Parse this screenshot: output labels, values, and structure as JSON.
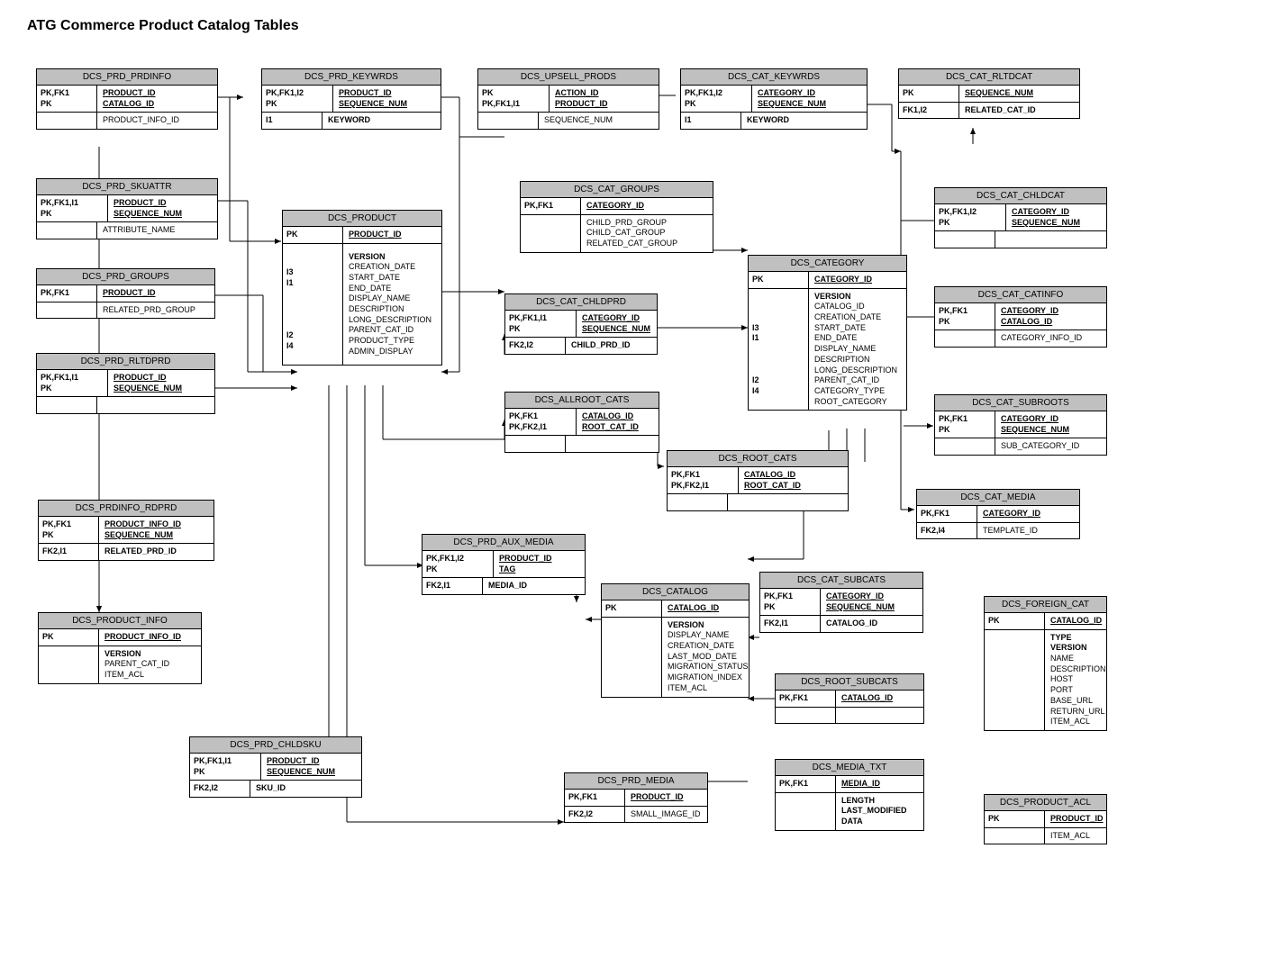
{
  "title": "ATG Commerce Product Catalog Tables",
  "tables": {
    "prd_prdinfo": {
      "name": "DCS_PRD_PRDINFO",
      "rows": [
        {
          "k": [
            "PK,FK1",
            "PK"
          ],
          "v": [
            "PRODUCT_ID",
            "CATALOG_ID"
          ],
          "ui": true
        },
        {
          "k": [
            ""
          ],
          "v": [
            "PRODUCT_INFO_ID"
          ],
          "vi": false
        }
      ]
    },
    "prd_skuattr": {
      "name": "DCS_PRD_SKUATTR",
      "rows": [
        {
          "k": [
            "PK,FK1,I1",
            "PK"
          ],
          "v": [
            "PRODUCT_ID",
            "SEQUENCE_NUM"
          ],
          "ui": true
        },
        {
          "k": [
            ""
          ],
          "v": [
            "ATTRIBUTE_NAME"
          ],
          "vi": false
        }
      ]
    },
    "prd_groups": {
      "name": "DCS_PRD_GROUPS",
      "rows": [
        {
          "k": [
            "PK,FK1"
          ],
          "v": [
            "PRODUCT_ID"
          ],
          "ui": true
        },
        {
          "k": [
            ""
          ],
          "v": [
            "RELATED_PRD_GROUP"
          ],
          "vi": false
        }
      ]
    },
    "prd_rltdprd": {
      "name": "DCS_PRD_RLTDPRD",
      "rows": [
        {
          "k": [
            "PK,FK1,I1",
            "PK"
          ],
          "v": [
            "PRODUCT_ID",
            "SEQUENCE_NUM"
          ],
          "ui": true
        },
        {
          "k": [
            ""
          ],
          "v": [
            ""
          ],
          "vi": false
        }
      ]
    },
    "prdinfo_rdprd": {
      "name": "DCS_PRDINFO_RDPRD",
      "rows": [
        {
          "k": [
            "PK,FK1",
            "PK"
          ],
          "v": [
            "PRODUCT_INFO_ID",
            "SEQUENCE_NUM"
          ],
          "ui": true
        },
        {
          "k": [
            "FK2,I1"
          ],
          "v": [
            "RELATED_PRD_ID"
          ],
          "vi": true
        }
      ]
    },
    "product_info": {
      "name": "DCS_PRODUCT_INFO",
      "rows": [
        {
          "k": [
            "PK"
          ],
          "v": [
            "PRODUCT_INFO_ID"
          ],
          "ui": true
        },
        {
          "k": [
            ""
          ],
          "v": [
            "VERSION",
            "PARENT_CAT_ID",
            "ITEM_ACL"
          ],
          "vi": false,
          "firstbold": true
        }
      ]
    },
    "prd_chldsku": {
      "name": "DCS_PRD_CHLDSKU",
      "rows": [
        {
          "k": [
            "PK,FK1,I1",
            "PK"
          ],
          "v": [
            "PRODUCT_ID",
            "SEQUENCE_NUM"
          ],
          "ui": true
        },
        {
          "k": [
            "FK2,I2"
          ],
          "v": [
            "SKU_ID"
          ],
          "vi": true
        }
      ]
    },
    "prd_keywrds": {
      "name": "DCS_PRD_KEYWRDS",
      "rows": [
        {
          "k": [
            "PK,FK1,I2",
            "PK"
          ],
          "v": [
            "PRODUCT_ID",
            "SEQUENCE_NUM"
          ],
          "ui": true
        },
        {
          "k": [
            "I1"
          ],
          "v": [
            "KEYWORD"
          ],
          "vi": true
        }
      ]
    },
    "product": {
      "name": "DCS_PRODUCT",
      "rows": [
        {
          "k": [
            "PK"
          ],
          "v": [
            "PRODUCT_ID"
          ],
          "ui": true
        },
        {
          "k": [
            "",
            "",
            "I3",
            "I1",
            "",
            "",
            "",
            "",
            "I2",
            "I4",
            ""
          ],
          "v": [
            "VERSION",
            "CREATION_DATE",
            "START_DATE",
            "END_DATE",
            "DISPLAY_NAME",
            "DESCRIPTION",
            "LONG_DESCRIPTION",
            "PARENT_CAT_ID",
            "PRODUCT_TYPE",
            "ADMIN_DISPLAY"
          ],
          "vi": false,
          "firstbold": true
        }
      ]
    },
    "upsell_prods": {
      "name": "DCS_UPSELL_PRODS",
      "rows": [
        {
          "k": [
            "PK",
            "PK,FK1,I1"
          ],
          "v": [
            "ACTION_ID",
            "PRODUCT_ID"
          ],
          "ui": true
        },
        {
          "k": [
            ""
          ],
          "v": [
            "SEQUENCE_NUM"
          ],
          "vi": false
        }
      ]
    },
    "prd_aux_media": {
      "name": "DCS_PRD_AUX_MEDIA",
      "rows": [
        {
          "k": [
            "PK,FK1,I2",
            "PK"
          ],
          "v": [
            "PRODUCT_ID",
            "TAG"
          ],
          "ui": true
        },
        {
          "k": [
            "FK2,I1"
          ],
          "v": [
            "MEDIA_ID"
          ],
          "vi": true
        }
      ]
    },
    "cat_groups": {
      "name": "DCS_CAT_GROUPS",
      "rows": [
        {
          "k": [
            "PK,FK1"
          ],
          "v": [
            "CATEGORY_ID"
          ],
          "ui": true
        },
        {
          "k": [
            ""
          ],
          "v": [
            "CHILD_PRD_GROUP",
            "CHILD_CAT_GROUP",
            "RELATED_CAT_GROUP"
          ],
          "vi": false
        }
      ]
    },
    "cat_chldprd": {
      "name": "DCS_CAT_CHLDPRD",
      "rows": [
        {
          "k": [
            "PK,FK1,I1",
            "PK"
          ],
          "v": [
            "CATEGORY_ID",
            "SEQUENCE_NUM"
          ],
          "ui": true
        },
        {
          "k": [
            "FK2,I2"
          ],
          "v": [
            "CHILD_PRD_ID"
          ],
          "vi": true
        }
      ]
    },
    "allroot_cats": {
      "name": "DCS_ALLROOT_CATS",
      "rows": [
        {
          "k": [
            "PK,FK1",
            "PK,FK2,I1"
          ],
          "v": [
            "CATALOG_ID",
            "ROOT_CAT_ID"
          ],
          "ui": true
        },
        {
          "k": [
            ""
          ],
          "v": [
            ""
          ],
          "vi": false
        }
      ]
    },
    "catalog": {
      "name": "DCS_CATALOG",
      "rows": [
        {
          "k": [
            "PK"
          ],
          "v": [
            "CATALOG_ID"
          ],
          "ui": true
        },
        {
          "k": [
            ""
          ],
          "v": [
            "VERSION",
            "DISPLAY_NAME",
            "CREATION_DATE",
            "LAST_MOD_DATE",
            "MIGRATION_STATUS",
            "MIGRATION_INDEX",
            "ITEM_ACL"
          ],
          "vi": false,
          "firstbold": true
        }
      ]
    },
    "prd_media": {
      "name": "DCS_PRD_MEDIA",
      "rows": [
        {
          "k": [
            "PK,FK1"
          ],
          "v": [
            "PRODUCT_ID"
          ],
          "ui": true
        },
        {
          "k": [
            "FK2,I2"
          ],
          "v": [
            "SMALL_IMAGE_ID"
          ],
          "vi": false
        }
      ]
    },
    "cat_keywrds": {
      "name": "DCS_CAT_KEYWRDS",
      "rows": [
        {
          "k": [
            "PK,FK1,I2",
            "PK"
          ],
          "v": [
            "CATEGORY_ID",
            "SEQUENCE_NUM"
          ],
          "ui": true
        },
        {
          "k": [
            "I1"
          ],
          "v": [
            "KEYWORD"
          ],
          "vi": true
        }
      ]
    },
    "category": {
      "name": "DCS_CATEGORY",
      "rows": [
        {
          "k": [
            "PK"
          ],
          "v": [
            "CATEGORY_ID"
          ],
          "ui": true
        },
        {
          "k": [
            "",
            "",
            "",
            "I3",
            "I1",
            "",
            "",
            "",
            "I2",
            "I4",
            ""
          ],
          "v": [
            "VERSION",
            "CATALOG_ID",
            "CREATION_DATE",
            "START_DATE",
            "END_DATE",
            "DISPLAY_NAME",
            "DESCRIPTION",
            "LONG_DESCRIPTION",
            "PARENT_CAT_ID",
            "CATEGORY_TYPE",
            "ROOT_CATEGORY"
          ],
          "vi": false,
          "firstbold": true
        }
      ]
    },
    "root_cats": {
      "name": "DCS_ROOT_CATS",
      "rows": [
        {
          "k": [
            "PK,FK1",
            "PK,FK2,I1"
          ],
          "v": [
            "CATALOG_ID",
            "ROOT_CAT_ID"
          ],
          "ui": true
        },
        {
          "k": [
            ""
          ],
          "v": [
            ""
          ],
          "vi": false
        }
      ]
    },
    "cat_subcats": {
      "name": "DCS_CAT_SUBCATS",
      "rows": [
        {
          "k": [
            "PK,FK1",
            "PK"
          ],
          "v": [
            "CATEGORY_ID",
            "SEQUENCE_NUM"
          ],
          "ui": true
        },
        {
          "k": [
            "FK2,I1"
          ],
          "v": [
            "CATALOG_ID"
          ],
          "vi": true
        }
      ]
    },
    "root_subcats": {
      "name": "DCS_ROOT_SUBCATS",
      "rows": [
        {
          "k": [
            "PK,FK1"
          ],
          "v": [
            "CATALOG_ID"
          ],
          "ui": true
        },
        {
          "k": [
            ""
          ],
          "v": [
            ""
          ],
          "vi": false
        }
      ]
    },
    "media_txt": {
      "name": "DCS_MEDIA_TXT",
      "rows": [
        {
          "k": [
            "PK,FK1"
          ],
          "v": [
            "MEDIA_ID"
          ],
          "ui": true
        },
        {
          "k": [
            ""
          ],
          "v": [
            "LENGTH",
            "LAST_MODIFIED",
            "DATA"
          ],
          "vi": true
        }
      ]
    },
    "cat_rltdcat": {
      "name": "DCS_CAT_RLTDCAT",
      "rows": [
        {
          "k": [
            "PK"
          ],
          "v": [
            "SEQUENCE_NUM"
          ],
          "ui": true
        },
        {
          "k": [
            "FK1,I2"
          ],
          "v": [
            "RELATED_CAT_ID"
          ],
          "vi": true
        }
      ]
    },
    "cat_chldcat": {
      "name": "DCS_CAT_CHLDCAT",
      "rows": [
        {
          "k": [
            "PK,FK1,I2",
            "PK"
          ],
          "v": [
            "CATEGORY_ID",
            "SEQUENCE_NUM"
          ],
          "ui": true
        },
        {
          "k": [
            ""
          ],
          "v": [
            ""
          ],
          "vi": false
        }
      ]
    },
    "cat_catinfo": {
      "name": "DCS_CAT_CATINFO",
      "rows": [
        {
          "k": [
            "PK,FK1",
            "PK"
          ],
          "v": [
            "CATEGORY_ID",
            "CATALOG_ID"
          ],
          "ui": true
        },
        {
          "k": [
            ""
          ],
          "v": [
            "CATEGORY_INFO_ID"
          ],
          "vi": false
        }
      ]
    },
    "cat_subroots": {
      "name": "DCS_CAT_SUBROOTS",
      "rows": [
        {
          "k": [
            "PK,FK1",
            "PK"
          ],
          "v": [
            "CATEGORY_ID",
            "SEQUENCE_NUM"
          ],
          "ui": true
        },
        {
          "k": [
            ""
          ],
          "v": [
            "SUB_CATEGORY_ID"
          ],
          "vi": false
        }
      ]
    },
    "cat_media": {
      "name": "DCS_CAT_MEDIA",
      "rows": [
        {
          "k": [
            "PK,FK1"
          ],
          "v": [
            "CATEGORY_ID"
          ],
          "ui": true
        },
        {
          "k": [
            "FK2,I4"
          ],
          "v": [
            "TEMPLATE_ID"
          ],
          "vi": false
        }
      ]
    },
    "foreign_cat": {
      "name": "DCS_FOREIGN_CAT",
      "rows": [
        {
          "k": [
            "PK"
          ],
          "v": [
            "CATALOG_ID"
          ],
          "ui": true
        },
        {
          "k": [
            ""
          ],
          "v": [
            "TYPE",
            "VERSION",
            "NAME",
            "DESCRIPTION",
            "HOST",
            "PORT",
            "BASE_URL",
            "RETURN_URL",
            "ITEM_ACL"
          ],
          "vi": false,
          "firstbold2": true
        }
      ]
    },
    "product_acl": {
      "name": "DCS_PRODUCT_ACL",
      "rows": [
        {
          "k": [
            "PK"
          ],
          "v": [
            "PRODUCT_ID"
          ],
          "ui": true
        },
        {
          "k": [
            ""
          ],
          "v": [
            "ITEM_ACL"
          ],
          "vi": false
        }
      ]
    }
  }
}
